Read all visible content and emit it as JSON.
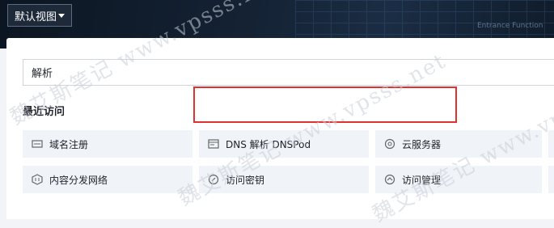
{
  "view_selector": {
    "label": "默认视图",
    "icon": "chevron-down-icon"
  },
  "banner": {
    "faint_text": "Entrance Function"
  },
  "search": {
    "value": "解析"
  },
  "recent": {
    "title": "最近访问",
    "items": [
      {
        "label": "域名注册",
        "icon": "domain-icon"
      },
      {
        "label": "DNS 解析 DNSPod",
        "icon": "dns-icon"
      },
      {
        "label": "云服务器",
        "icon": "server-icon"
      },
      {
        "label": "内容分发网络",
        "icon": "cdn-icon"
      },
      {
        "label": "访问密钥",
        "icon": "key-icon"
      },
      {
        "label": "访问管理",
        "icon": "access-icon"
      }
    ]
  },
  "watermark": {
    "text": "魏艾斯笔记 www.vpsss.net"
  },
  "colors": {
    "highlight": "#e0312f",
    "banner": "#142234",
    "tile": "#f0f3f8"
  }
}
